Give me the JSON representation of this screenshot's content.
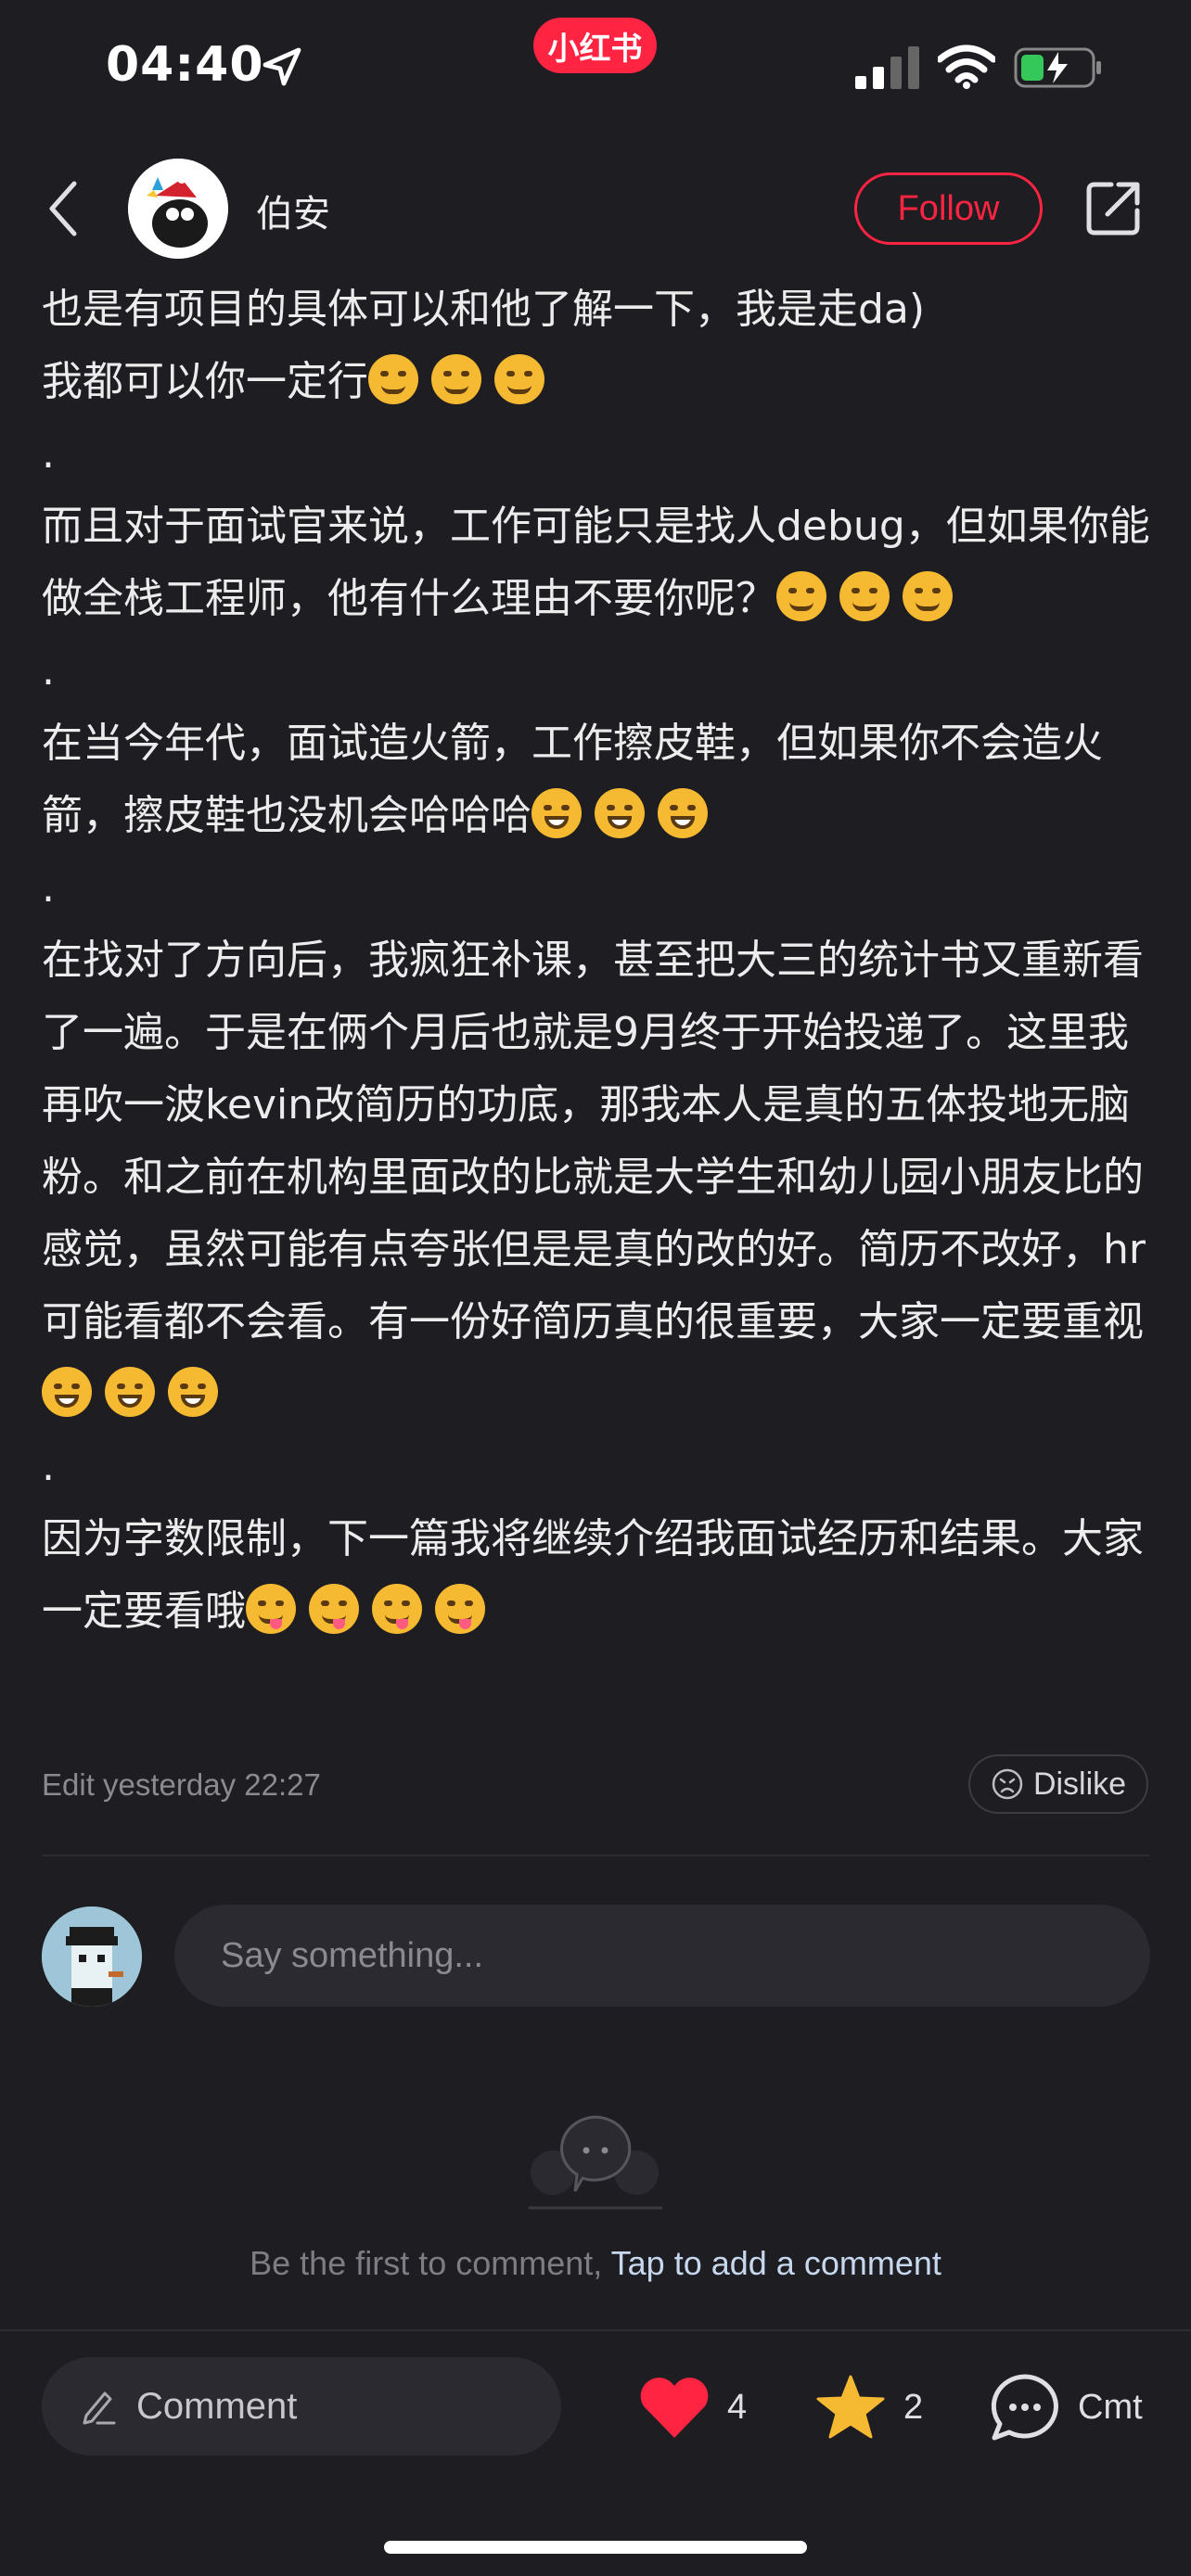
{
  "status_bar": {
    "time": "04:40",
    "app_badge": "小红书"
  },
  "header": {
    "author_name": "伯安",
    "follow_label": "Follow"
  },
  "post": {
    "paragraphs": [
      "也是有项目的具体可以和他了解一下，我是走da)",
      "我都可以你一定行",
      ".",
      "而且对于面试官来说，工作可能只是找人debug，但如果你能做全栈工程师，他有什么理由不要你呢？",
      ".",
      "在当今年代，面试造火箭，工作擦皮鞋，但如果你不会造火箭，擦皮鞋也没机会哈哈哈",
      ".",
      "在找对了方向后，我疯狂补课，甚至把大三的统计书又重新看了一遍。于是在俩个月后也就是9月终于开始投递了。这里我再吹一波kevin改简历的功底，那我本人是真的五体投地无脑粉。和之前在机构里面改的比就是大学生和幼儿园小朋友比的感觉，虽然可能有点夸张但是是真的改的好。简历不改好，hr可能看都不会看。有一份好简历真的很重要，大家一定要重视",
      ".",
      "因为字数限制，下一篇我将继续介绍我面试经历和结果。大家一定要看哦"
    ],
    "emoji": {
      "smirk": "smirking-face-icon",
      "grin": "grinning-face-icon",
      "smiley": "smiley-face-icon",
      "yum": "yum-face-icon"
    },
    "edit_meta": "Edit yesterday 22:27",
    "dislike_label": "Dislike"
  },
  "comment_box": {
    "placeholder": "Say something..."
  },
  "empty_comments": {
    "text": "Be the first to comment,",
    "link": "Tap to add a comment"
  },
  "bottom_bar": {
    "comment_label": "Comment",
    "likes": "4",
    "stars": "2",
    "cmt_label": "Cmt"
  },
  "colors": {
    "accent": "#ff2442",
    "background": "#1d1d22",
    "link": "#c7d8ee"
  }
}
